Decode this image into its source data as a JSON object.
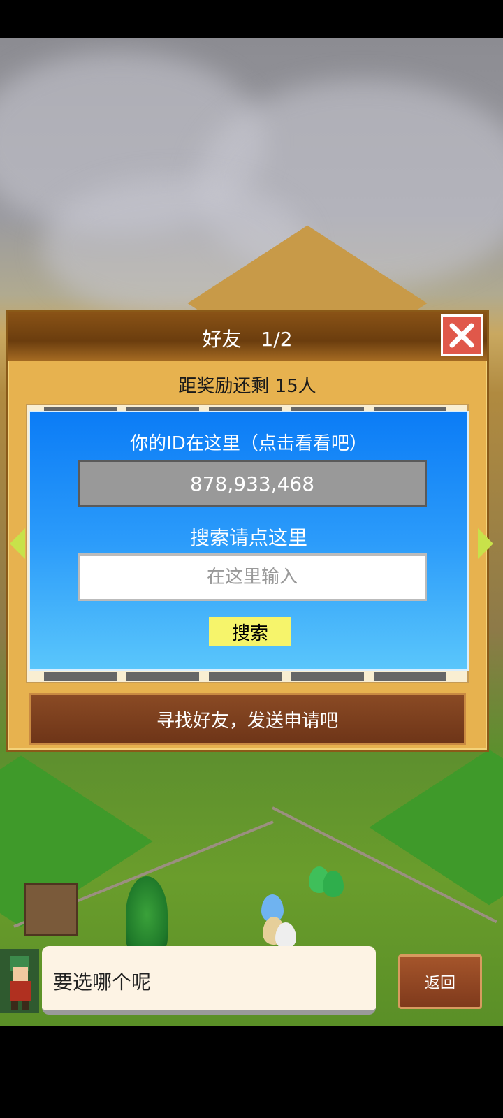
{
  "dialog": {
    "title": "好友　1/2",
    "close_icon": "close-x-icon",
    "reward_text": "距奖励还剩 15人",
    "id_label": "你的ID在这里（点击看看吧）",
    "id_value": "878,933,468",
    "search_label": "搜索请点这里",
    "search_placeholder": "在这里输入",
    "search_button": "搜索",
    "find_friends_button": "寻找好友，发送申请吧",
    "prev_icon": "arrow-left-icon",
    "next_icon": "arrow-right-icon"
  },
  "message": {
    "text": "要选哪个呢"
  },
  "back_button": "返回",
  "colors": {
    "panel_blue": "#0b7cf6",
    "dialog_gold": "#e7b24f",
    "search_button_yellow": "#f6f46b",
    "close_red": "#e0584a"
  }
}
